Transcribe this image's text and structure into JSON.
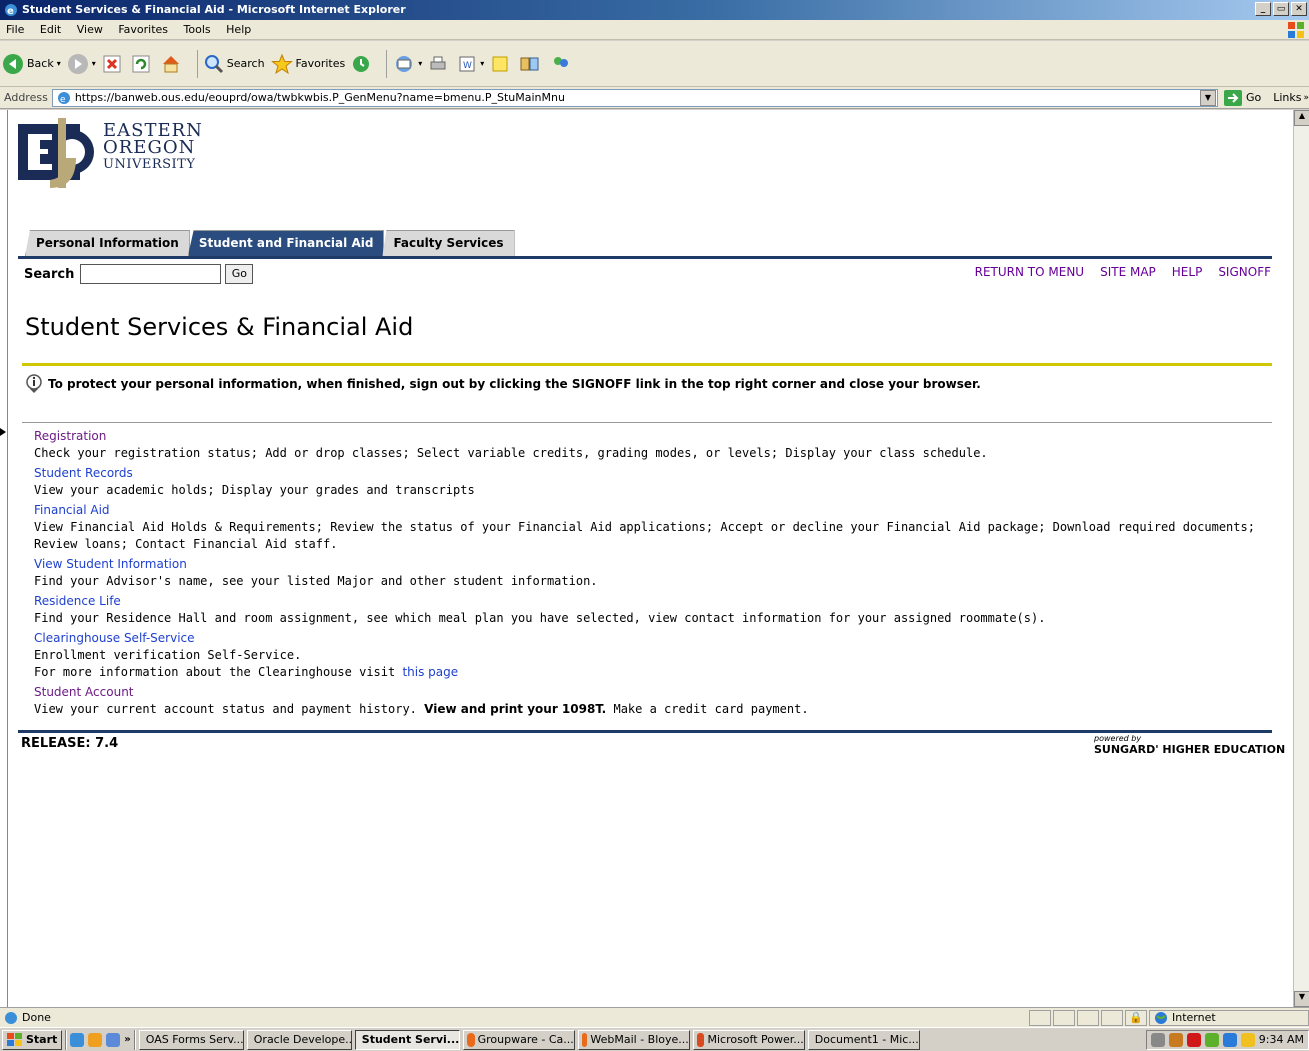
{
  "window": {
    "title": "Student Services & Financial Aid - Microsoft Internet Explorer",
    "buttons": [
      "_",
      "▭",
      "✕"
    ]
  },
  "menubar": [
    "File",
    "Edit",
    "View",
    "Favorites",
    "Tools",
    "Help"
  ],
  "toolbar": {
    "back": "Back",
    "search": "Search",
    "favorites": "Favorites"
  },
  "address": {
    "label": "Address",
    "url": "https://banweb.ous.edu/eouprd/owa/twbkwbis.P_GenMenu?name=bmenu.P_StuMainMnu",
    "go": "Go",
    "links": "Links"
  },
  "logo": {
    "line1": "EASTERN",
    "line2": "OREGON",
    "line3": "UNIVERSITY"
  },
  "tabs": [
    {
      "label": "Personal Information",
      "active": false
    },
    {
      "label": "Student and Financial Aid",
      "active": true
    },
    {
      "label": "Faculty Services",
      "active": false
    }
  ],
  "search": {
    "label": "Search",
    "value": "",
    "button": "Go"
  },
  "top_links": [
    "RETURN TO MENU",
    "SITE MAP",
    "HELP",
    "SIGNOFF"
  ],
  "page_title": "Student Services & Financial Aid",
  "info_message": "To protect your personal information, when finished, sign out by clicking the SIGNOFF link in the top right corner and close your browser.",
  "menu_items": [
    {
      "title": "Registration",
      "desc": "Check your registration status; Add or drop classes; Select variable credits, grading modes, or levels; Display your class schedule."
    },
    {
      "title": "Student Records",
      "desc": "View your academic holds; Display your grades and transcripts"
    },
    {
      "title": "Financial Aid",
      "desc": "View Financial Aid Holds & Requirements; Review the status of your Financial Aid applications; Accept or decline your Financial Aid package; Download required documents; Review loans; Contact Financial Aid staff."
    },
    {
      "title": "View Student Information",
      "desc": "Find your Advisor's name, see your listed Major and other student information."
    },
    {
      "title": "Residence Life",
      "desc": "Find your Residence Hall and room assignment, see which meal plan you have selected, view contact information for your assigned roommate(s)."
    },
    {
      "title": "Clearinghouse Self-Service",
      "desc": "Enrollment verification Self-Service.",
      "desc2_prefix": "For more information about the Clearinghouse visit ",
      "desc2_link": "this page"
    },
    {
      "title": "Student Account",
      "desc_prefix": "View your current account status and payment history. ",
      "desc_bold": "View and print your 1098T.",
      "desc_suffix": " Make a credit card payment."
    }
  ],
  "release": "RELEASE: 7.4",
  "powered_by": {
    "line1": "powered by",
    "line2": "SUNGARD' HIGHER EDUCATION"
  },
  "status": {
    "text": "Done",
    "zone": "Internet"
  },
  "taskbar": {
    "start": "Start",
    "tasks": [
      {
        "label": "OAS Forms Serv...",
        "active": false
      },
      {
        "label": "Oracle Develope...",
        "active": false
      },
      {
        "label": "Student Servi...",
        "active": true
      },
      {
        "label": "Groupware - Ca...",
        "active": false
      },
      {
        "label": "WebMail - Bloye...",
        "active": false
      },
      {
        "label": "Microsoft Power...",
        "active": false
      },
      {
        "label": "Document1 - Mic...",
        "active": false
      }
    ],
    "clock": "9:34 AM"
  },
  "colors": {
    "tab_active": "#2b4c7e",
    "nav_line": "#1d3b66",
    "yellow_rule": "#cfc800",
    "link": "#1d3fcf",
    "visited": "#6d1b86"
  }
}
